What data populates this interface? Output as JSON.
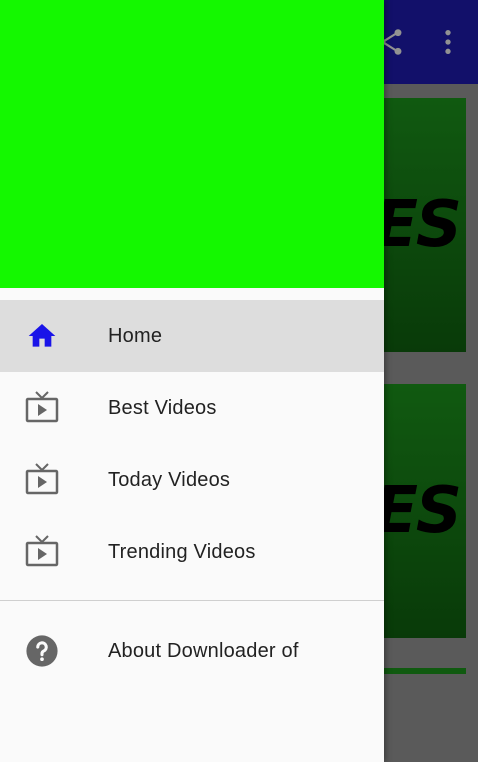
{
  "app_bar": {
    "actions": [
      {
        "icon": "share-icon"
      },
      {
        "icon": "more-vert-icon"
      }
    ]
  },
  "content": {
    "card_text": "ES"
  },
  "drawer": {
    "header_color": "#14f800",
    "items": [
      {
        "label": "Home",
        "icon": "home-icon",
        "active": true
      },
      {
        "label": "Best Videos",
        "icon": "tv-play-icon"
      },
      {
        "label": "Today Videos",
        "icon": "tv-play-icon"
      },
      {
        "label": "Trending Videos",
        "icon": "tv-play-icon"
      }
    ],
    "secondary_items": [
      {
        "label": "About Downloader of",
        "icon": "help-icon"
      }
    ]
  },
  "colors": {
    "app_bar": "#1d1aa3",
    "active_icon": "#1a14e8",
    "icon_gray": "#666666"
  }
}
